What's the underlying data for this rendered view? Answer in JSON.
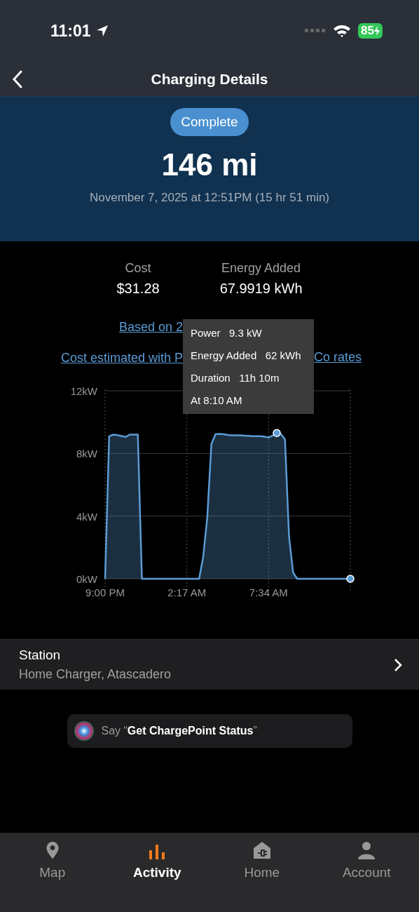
{
  "status_bar": {
    "time": "11:01",
    "battery": "85"
  },
  "nav": {
    "title": "Charging Details"
  },
  "summary": {
    "status": "Complete",
    "distance": "146 mi",
    "date": "November 7, 2025 at 12:51PM (15 hr 51 min)"
  },
  "stats": [
    {
      "label": "Cost",
      "value": "$31.28"
    },
    {
      "label": "Energy Added",
      "value": "67.9919 kWh"
    }
  ],
  "links": [
    {
      "parts": [
        "Based on 2"
      ]
    },
    {
      "parts": [
        "Cost estimated with P",
        "Co rates"
      ]
    }
  ],
  "chart": {
    "chart_data": {
      "type": "area",
      "categories": [
        "9:00 PM",
        null,
        null,
        null,
        null,
        null,
        null,
        null,
        null,
        null,
        null,
        null,
        null,
        null,
        null,
        null,
        null,
        null,
        null,
        null,
        "2:17 AM",
        null,
        null,
        null,
        null,
        null,
        null,
        null,
        null,
        null,
        null,
        null,
        null,
        null,
        null,
        null,
        null,
        null,
        null,
        null,
        "7:34 AM",
        null,
        null,
        null,
        null,
        null,
        null,
        null,
        null,
        null,
        null,
        null,
        null,
        null,
        null,
        null,
        null,
        null,
        null,
        null,
        null
      ],
      "series": [
        {
          "color": "#5b9bd5",
          "values": [
            0,
            9.1,
            9.2,
            9.17,
            9.11,
            9.05,
            9.2,
            9.2,
            9.2,
            0,
            0,
            0,
            0,
            0,
            0,
            0,
            0,
            0,
            0,
            0,
            0,
            0,
            0,
            0,
            1.4,
            3.9,
            8.6,
            9.22,
            9.25,
            9.22,
            9.18,
            9.15,
            9.15,
            9.15,
            9.14,
            9.12,
            9.1,
            9.1,
            9.1,
            9.07,
            9.02,
            9.14,
            9.3,
            9.24,
            8.9,
            2.7,
            0.4,
            0,
            0,
            0,
            0,
            0,
            0,
            0,
            0,
            0,
            0,
            0,
            0,
            0,
            0
          ]
        }
      ],
      "ylim": [
        0,
        12
      ],
      "grid": true,
      "yticks": [
        {
          "value": 0,
          "label": "0kW"
        },
        {
          "value": 4,
          "label": "4kW"
        },
        {
          "value": 8,
          "label": "8kW"
        },
        {
          "value": 12,
          "label": "12kW"
        }
      ]
    },
    "tooltip": {
      "rows": [
        {
          "label": "Power",
          "value": "9.3 kW"
        },
        {
          "label": "Energy Added",
          "value": "62 kWh"
        },
        {
          "label": "Duration",
          "value": "11h 10m"
        }
      ],
      "time": "At 8:10 AM"
    }
  },
  "station": {
    "label": "Station",
    "value": "Home Charger, Atascadero"
  },
  "siri": {
    "text": "Say “**Get ChargePoint Status**”"
  },
  "tabs": [
    {
      "label": "Map",
      "selected": false
    },
    {
      "label": "Activity",
      "selected": true
    },
    {
      "label": "Home",
      "selected": false
    },
    {
      "label": "Account",
      "selected": false
    }
  ]
}
